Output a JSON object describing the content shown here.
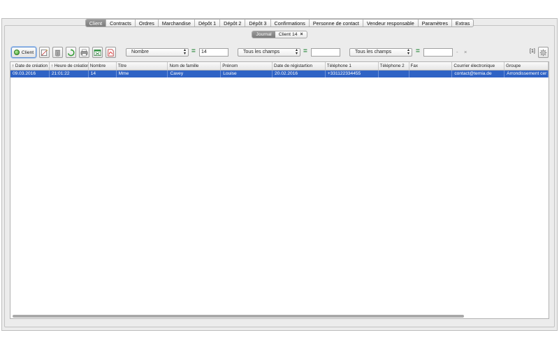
{
  "main_tabs": [
    {
      "label": "Client",
      "active": true
    },
    {
      "label": "Contracts"
    },
    {
      "label": "Ordres"
    },
    {
      "label": "Marchandise"
    },
    {
      "label": "Dépôt 1"
    },
    {
      "label": "Dépôt 2"
    },
    {
      "label": "Dépôt 3"
    },
    {
      "label": "Confirmations"
    },
    {
      "label": "Personne de contact"
    },
    {
      "label": "Vendeur responsable"
    },
    {
      "label": "Paramètres"
    },
    {
      "label": "Extras"
    }
  ],
  "sub_tabs": {
    "journal": "Journal",
    "client_tab": "Client 14",
    "close_glyph": "×"
  },
  "toolbar": {
    "client_button": "Client",
    "filter1_field": "Nombre",
    "filter1_eq": "=",
    "filter1_value": "14",
    "filter2_field": "Tous les champs",
    "filter2_eq": "=",
    "filter2_value": "",
    "filter3_field": "Tous les champs",
    "filter3_eq": "=",
    "filter3_value": "",
    "minus": "-",
    "clear": "×",
    "result_count": "[1]"
  },
  "table": {
    "columns": [
      "↑ Date de création",
      "↑ Heure de création",
      "Nombre",
      "Titre",
      "Nom de famille",
      "Prénom",
      "Date de régistartion",
      "Téléphone 1",
      "Téléphone 2",
      "Fax",
      "Courrier électronique",
      "Groupe"
    ],
    "rows": [
      [
        "09.03.2016",
        "21:01:22",
        "14",
        "Mme",
        "Cavey",
        "Louise",
        "20.02.2016",
        "+331122334455",
        "",
        "",
        "contact@temia.de",
        "Arrondissement cer"
      ]
    ]
  }
}
